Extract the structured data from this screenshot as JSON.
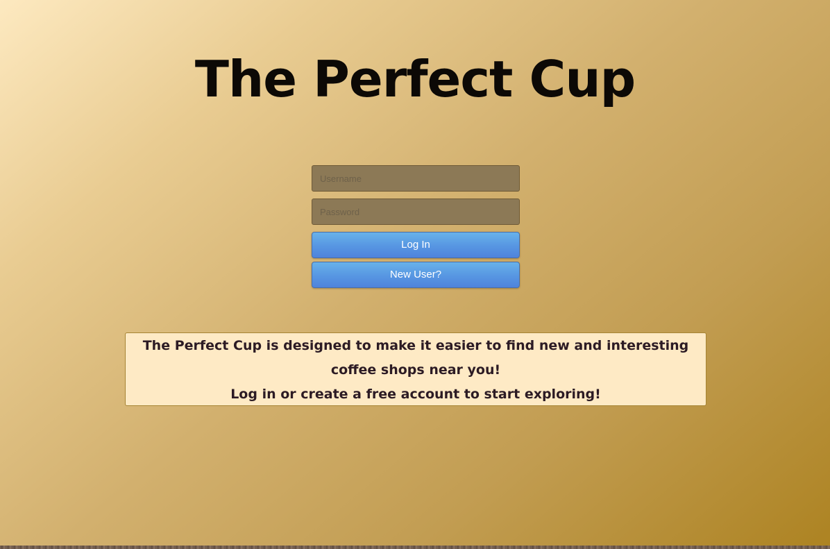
{
  "app": {
    "title": "The Perfect Cup"
  },
  "login_form": {
    "username": {
      "placeholder": "Username",
      "value": ""
    },
    "password": {
      "placeholder": "Password",
      "value": ""
    },
    "login_label": "Log In",
    "new_user_label": "New User?"
  },
  "info": {
    "line1": "The Perfect Cup is designed to make it easier to find new and interesting coffee shops near you!",
    "line2": "Log in or create a free account to start exploring!"
  },
  "colors": {
    "background_light": "#fde9c0",
    "background_dark": "#ad8322",
    "button_blue": "#5796e2",
    "input_fill": "#8c7956",
    "info_box": "#feeac5",
    "title_text": "#0c0906"
  }
}
